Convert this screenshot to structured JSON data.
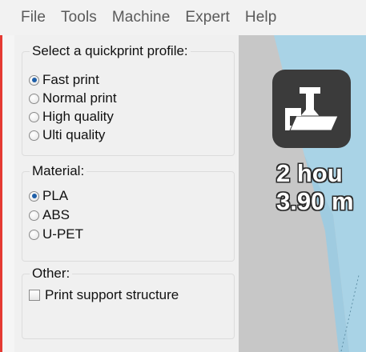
{
  "menu": [
    "File",
    "Tools",
    "Machine",
    "Expert",
    "Help"
  ],
  "profile": {
    "title": "Select a quickprint profile:",
    "options": [
      "Fast print",
      "Normal print",
      "High quality",
      "Ulti quality"
    ],
    "selected": "Fast print"
  },
  "material": {
    "title": "Material:",
    "options": [
      "PLA",
      "ABS",
      "U-PET"
    ],
    "selected": "PLA"
  },
  "other": {
    "title": "Other:",
    "support_label": "Print support structure",
    "support_checked": false
  },
  "viewport": {
    "time": "2 hou",
    "length": "3.90 m",
    "icon": "load-model-icon"
  },
  "colors": {
    "accent": "#1e5fa8",
    "icon_bg": "#3b3b3b",
    "platform": "#a9d3e6",
    "window_edge": "#e53a33"
  }
}
